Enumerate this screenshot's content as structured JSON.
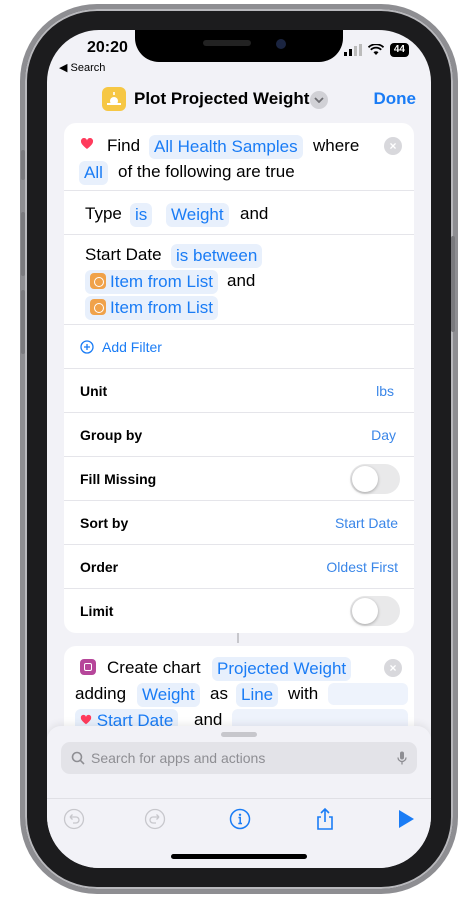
{
  "status": {
    "time": "20:20",
    "back_label": "◀ Search",
    "battery": "44"
  },
  "nav": {
    "title": "Plot Projected Weight",
    "done_label": "Done"
  },
  "find_action": {
    "find_label": "Find",
    "source_token": "All Health Samples",
    "where_label": "where",
    "mode_token": "All",
    "following_label": "of the following are true",
    "filter1": {
      "field": "Type",
      "op": "is",
      "value": "Weight",
      "and": "and"
    },
    "filter2": {
      "field": "Start Date",
      "op": "is between",
      "value1": "Item from List",
      "and": "and",
      "value2": "Item from List"
    },
    "add_filter_label": "Add Filter",
    "settings": [
      {
        "label": "Unit",
        "value": "lbs"
      },
      {
        "label": "Group by",
        "value": "Day"
      },
      {
        "label": "Fill Missing",
        "toggle": false
      },
      {
        "label": "Sort by",
        "value": "Start Date"
      },
      {
        "label": "Order",
        "value": "Oldest First"
      },
      {
        "label": "Limit",
        "toggle": false
      }
    ]
  },
  "chart_action": {
    "create_label": "Create chart",
    "name_token": "Projected Weight",
    "adding_label": "adding",
    "series_token": "Weight",
    "as_label": "as",
    "type_token": "Line",
    "with_label": "with",
    "x_token": "Start Date",
    "and_label": "and"
  },
  "sheet": {
    "search_placeholder": "Search for apps and actions"
  },
  "colors": {
    "accent": "#1a7cf5",
    "token_bg": "#e8f0fc",
    "background": "#f2f2f7"
  }
}
